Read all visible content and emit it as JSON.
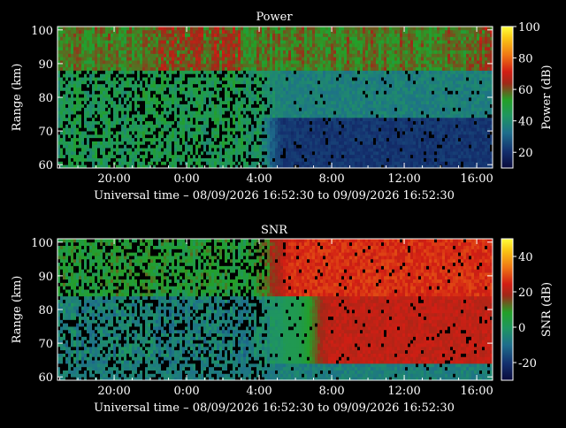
{
  "figure": {
    "background": "#000000",
    "text_color": "#ffffff"
  },
  "chart_data": [
    {
      "type": "heatmap",
      "title": "Power",
      "xlabel": "Universal time – 08/09/2026 16:52:30 to 09/09/2026 16:52:30",
      "ylabel": "Range (km)",
      "x_tick_labels": [
        "20:00",
        "0:00",
        "4:00",
        "8:00",
        "12:00",
        "16:00"
      ],
      "x_tick_hours": [
        20,
        24,
        28,
        32,
        36,
        40
      ],
      "xlim_hours": [
        16.875,
        40.875
      ],
      "y_ticks": [
        60,
        70,
        80,
        90,
        100
      ],
      "ylim": [
        59,
        101
      ],
      "colorbar": {
        "label": "Power (dB)",
        "ticks": [
          20,
          40,
          60,
          80,
          100
        ],
        "range": [
          10,
          100
        ]
      },
      "colormap": "blue-green-red-yellow",
      "field_description_levels": {
        "upper_band_90_100km": "50-70 dB throughout, red patches near 0:00 and 16:00",
        "lower_region_before_4h": "35-50 dB with many black data gaps",
        "lower_region_after_4h_60_75km": "10-25 dB (dark blue)",
        "lower_region_after_4h_75_88km": "25-40 dB (teal)"
      }
    },
    {
      "type": "heatmap",
      "title": "SNR",
      "xlabel": "Universal time – 08/09/2026 16:52:30 to 09/09/2026 16:52:30",
      "ylabel": "Range (km)",
      "x_tick_labels": [
        "20:00",
        "0:00",
        "4:00",
        "8:00",
        "12:00",
        "16:00"
      ],
      "x_tick_hours": [
        20,
        24,
        28,
        32,
        36,
        40
      ],
      "xlim_hours": [
        16.875,
        40.875
      ],
      "y_ticks": [
        60,
        70,
        80,
        90,
        100
      ],
      "ylim": [
        59,
        101
      ],
      "colorbar": {
        "label": "SNR (dB)",
        "ticks": [
          -20,
          0,
          20,
          40
        ],
        "range": [
          -30,
          50
        ]
      },
      "colormap": "blue-green-red-yellow",
      "field_description_levels": {
        "upper_band_before_4h": "0-15 dB with red patches",
        "lower_region_before_4h": "-10 to 5 dB with many black data gaps",
        "after_4h_85_100km": "15-30 dB (red/orange)",
        "after_6h_65_82km": "15-25 dB (red)"
      }
    }
  ]
}
